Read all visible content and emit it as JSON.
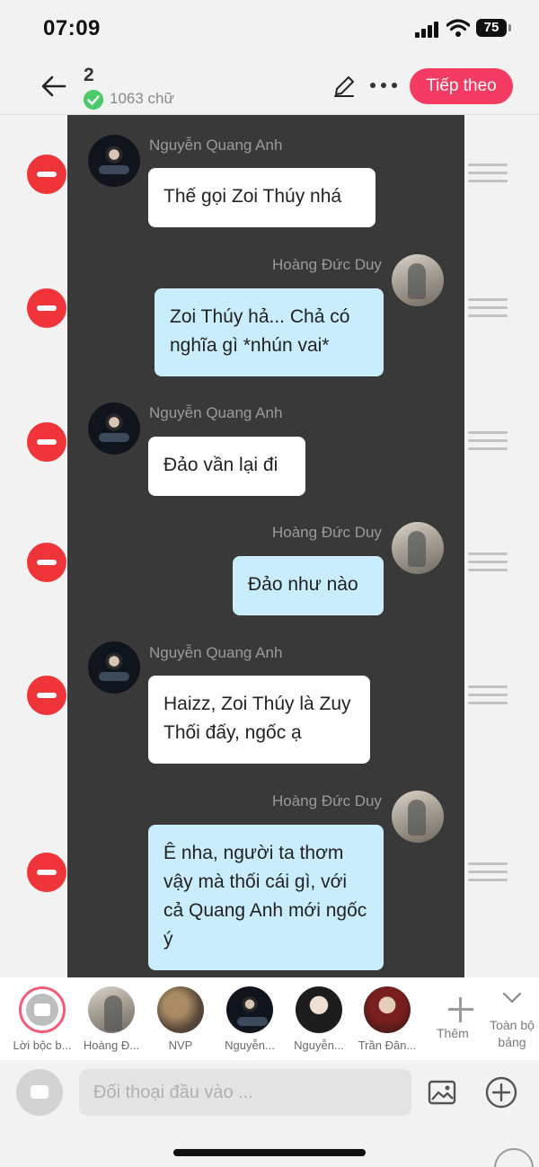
{
  "status_bar": {
    "time": "07:09",
    "battery": "75"
  },
  "header": {
    "chapter": "2",
    "word_count": "1063 chữ",
    "next_label": "Tiếp theo"
  },
  "messages": [
    {
      "speaker": "Nguyễn Quang Anh",
      "side": "left",
      "text": "Thế gọi Zoi Thúy nhá"
    },
    {
      "speaker": "Hoàng Đức Duy",
      "side": "right",
      "text": "Zoi Thúy hả... Chả có nghĩa gì *nhún vai*"
    },
    {
      "speaker": "Nguyễn Quang Anh",
      "side": "left",
      "text": "Đảo vần lại đi"
    },
    {
      "speaker": "Hoàng Đức Duy",
      "side": "right",
      "text": "Đảo như nào"
    },
    {
      "speaker": "Nguyễn Quang Anh",
      "side": "left",
      "text": "Haizz, Zoi Thúy là Zuy Thối đấy, ngốc ạ"
    },
    {
      "speaker": "Hoàng Đức Duy",
      "side": "right",
      "text": "Ê nha, người ta thơm vậy mà thối cái gì, với cả Quang Anh mới ngốc ý"
    }
  ],
  "characters": {
    "narration": "Lời bộc b...",
    "items": [
      "Hoàng Đ...",
      "NVP",
      "Nguyễn...",
      "Nguyễn...",
      "Trần Đăn..."
    ],
    "add_label": "Thêm",
    "all_label": "Toàn bộ bảng"
  },
  "input": {
    "placeholder": "Đối thoại đầu vào ..."
  }
}
